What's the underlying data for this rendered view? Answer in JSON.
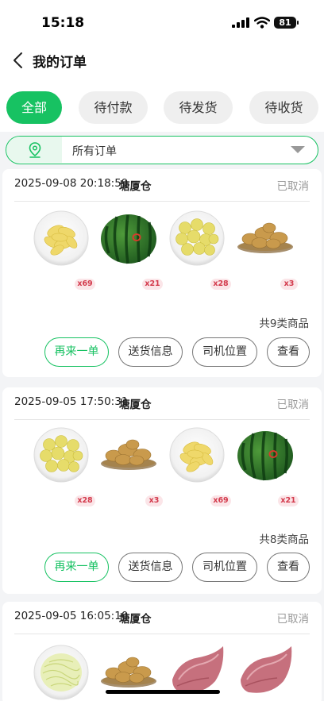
{
  "status_bar": {
    "time": "15:18",
    "battery": "81"
  },
  "header": {
    "title": "我的订单"
  },
  "tabs": [
    {
      "label": "全部",
      "active": true
    },
    {
      "label": "待付款",
      "active": false
    },
    {
      "label": "待发货",
      "active": false
    },
    {
      "label": "待收货",
      "active": false
    }
  ],
  "filter": {
    "label": "所有订单"
  },
  "orders": [
    {
      "datetime": "2025-09-08 20:18:59",
      "warehouse": "塘厦仓",
      "status": "已取消",
      "products": [
        {
          "icon": "sliced-potato-plate",
          "qty": "x69"
        },
        {
          "icon": "watermelon",
          "qty": "x21"
        },
        {
          "icon": "baby-potato-plate",
          "qty": "x28"
        },
        {
          "icon": "potato-basket",
          "qty": "x3"
        }
      ],
      "summary": "共9类商品",
      "actions": [
        "再来一单",
        "送货信息",
        "司机位置",
        "查看"
      ]
    },
    {
      "datetime": "2025-09-05 17:50:31",
      "warehouse": "塘厦仓",
      "status": "已取消",
      "products": [
        {
          "icon": "baby-potato-plate",
          "qty": "x28"
        },
        {
          "icon": "potato-basket",
          "qty": "x3"
        },
        {
          "icon": "sliced-potato-plate",
          "qty": "x69"
        },
        {
          "icon": "watermelon",
          "qty": "x21"
        }
      ],
      "summary": "共8类商品",
      "actions": [
        "再来一单",
        "送货信息",
        "司机位置",
        "查看"
      ]
    },
    {
      "datetime": "2025-09-05 16:05:10",
      "warehouse": "塘厦仓",
      "status": "已取消",
      "products": [
        {
          "icon": "shredded-cabbage-plate"
        },
        {
          "icon": "potato-basket"
        },
        {
          "icon": "raw-meat"
        },
        {
          "icon": "raw-meat"
        }
      ]
    }
  ],
  "colors": {
    "accent": "#17c262",
    "badge_bg": "#fbe5e8",
    "badge_text": "#d33a4c",
    "muted": "#999999"
  }
}
